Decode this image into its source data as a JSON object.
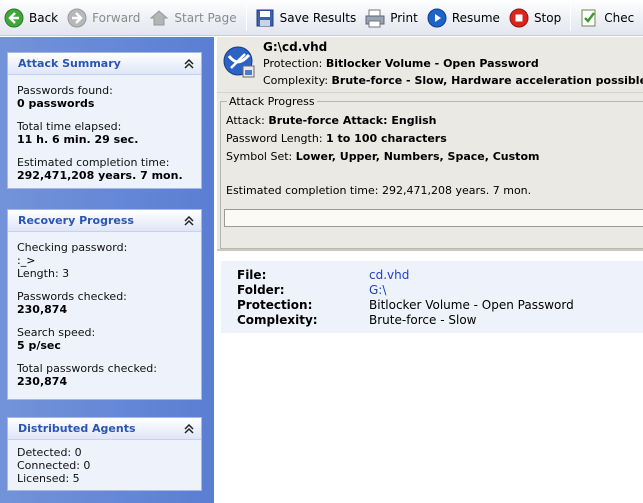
{
  "toolbar": {
    "back": "Back",
    "forward": "Forward",
    "start_page": "Start Page",
    "save_results": "Save Results",
    "print": "Print",
    "resume": "Resume",
    "stop": "Stop",
    "check": "Chec"
  },
  "attack_summary": {
    "title": "Attack Summary",
    "passwords_found_label": "Passwords found:",
    "passwords_found_value": "0 passwords",
    "time_elapsed_label": "Total time elapsed:",
    "time_elapsed_value": "11 h. 6 min. 29 sec.",
    "completion_label": "Estimated completion time:",
    "completion_value": "292,471,208 years. 7 mon."
  },
  "recovery_progress": {
    "title": "Recovery Progress",
    "checking_label": "Checking password:",
    "checking_value": ":_>",
    "length_label": "Length: 3",
    "checked_label": "Passwords checked:",
    "checked_value": "230,874",
    "speed_label": "Search speed:",
    "speed_value": "5 p/sec",
    "total_label": "Total passwords checked:",
    "total_value": "230,874"
  },
  "distributed_agents": {
    "title": "Distributed Agents",
    "detected": "Detected: 0",
    "connected": "Connected: 0",
    "licensed": "Licensed: 5"
  },
  "header": {
    "filename": "G:\\cd.vhd",
    "protection_label": "Protection:",
    "protection_value": "Bitlocker Volume - Open Password",
    "complexity_label": "Complexity:",
    "complexity_value": "Brute-force - Slow, Hardware acceleration possible"
  },
  "attack_progress": {
    "legend": "Attack Progress",
    "attack_label": "Attack:",
    "attack_value": "Brute-force Attack: English",
    "length_label": "Password Length:",
    "length_value": "1 to 100 characters",
    "symbol_label": "Symbol Set:",
    "symbol_value": "Lower, Upper, Numbers, Space, Custom",
    "estimated": "Estimated completion time: 292,471,208 years. 7 mon.",
    "progress_fraction": 0.0
  },
  "details": {
    "file_label": "File:",
    "file_value": "cd.vhd",
    "folder_label": "Folder:",
    "folder_value": "G:\\",
    "protection_label": "Protection:",
    "protection_value": "Bitlocker Volume - Open Password",
    "complexity_label": "Complexity:",
    "complexity_value": "Brute-force - Slow"
  },
  "colors": {
    "sidebar": "#6488d6",
    "panel_title": "#2a55b5",
    "link": "#1f3fc8",
    "stop_red": "#d9261c",
    "resume_blue": "#1e64c8"
  }
}
